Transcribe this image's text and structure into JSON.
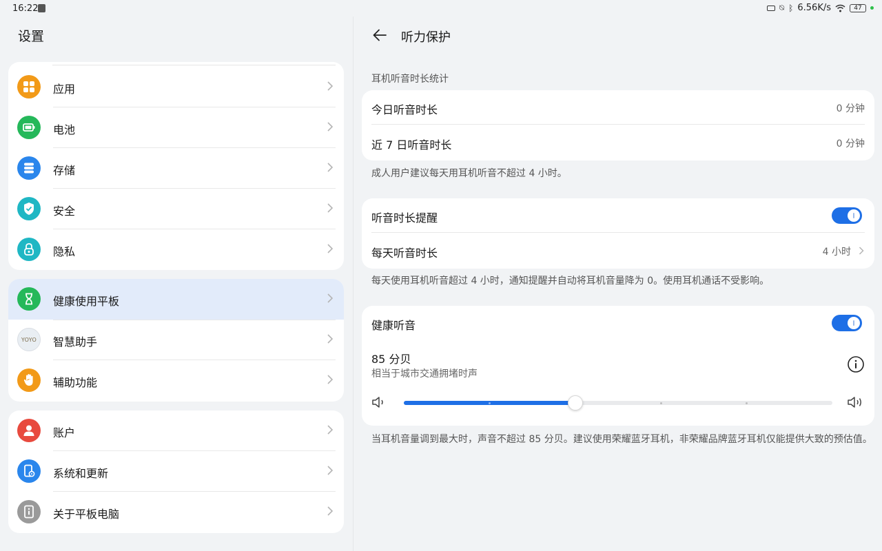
{
  "status_bar": {
    "time": "16:22",
    "speed": "6.56K/s",
    "battery": "47"
  },
  "left": {
    "title": "设置",
    "groups": [
      [
        {
          "label": "应用",
          "icon": "apps-icon",
          "color": "#f29a18"
        },
        {
          "label": "电池",
          "icon": "battery-icon",
          "color": "#25b85a"
        },
        {
          "label": "存储",
          "icon": "storage-icon",
          "color": "#2a86ec"
        },
        {
          "label": "安全",
          "icon": "security-shield-icon",
          "color": "#1fb7c4"
        },
        {
          "label": "隐私",
          "icon": "privacy-lock-icon",
          "color": "#1fb7c4"
        }
      ],
      [
        {
          "label": "健康使用平板",
          "icon": "hourglass-icon",
          "color": "#25b85a",
          "active": true
        },
        {
          "label": "智慧助手",
          "icon": "yoyo-assistant-icon",
          "color": "#e9eef3",
          "icon_text": "YOYO"
        },
        {
          "label": "辅助功能",
          "icon": "hand-icon",
          "color": "#f29a18"
        }
      ],
      [
        {
          "label": "账户",
          "icon": "account-icon",
          "color": "#e84a3e"
        },
        {
          "label": "系统和更新",
          "icon": "system-update-icon",
          "color": "#2a86ec"
        },
        {
          "label": "关于平板电脑",
          "icon": "about-tablet-icon",
          "color": "#9a9a9a"
        }
      ]
    ]
  },
  "right": {
    "title": "听力保护",
    "section_title": "耳机听音时长统计",
    "today_label": "今日听音时长",
    "today_value": "0 分钟",
    "week_label": "近 7 日听音时长",
    "week_value": "0 分钟",
    "note1": "成人用户建议每天用耳机听音不超过 4 小时。",
    "reminder_label": "听音时长提醒",
    "reminder_on": true,
    "daily_label": "每天听音时长",
    "daily_value": "4 小时",
    "note2": "每天使用耳机听音超过 4 小时，通知提醒并自动将耳机音量降为 0。使用耳机通话不受影响。",
    "healthy_label": "健康听音",
    "healthy_on": true,
    "db_value": "85 分贝",
    "db_desc": "相当于城市交通拥堵时声",
    "slider": {
      "value": 2,
      "max": 5
    },
    "note3": "当耳机音量调到最大时，声音不超过 85 分贝。建议使用荣耀蓝牙耳机，非荣耀品牌蓝牙耳机仅能提供大致的预估值。",
    "accent": "#1e6fe6"
  }
}
